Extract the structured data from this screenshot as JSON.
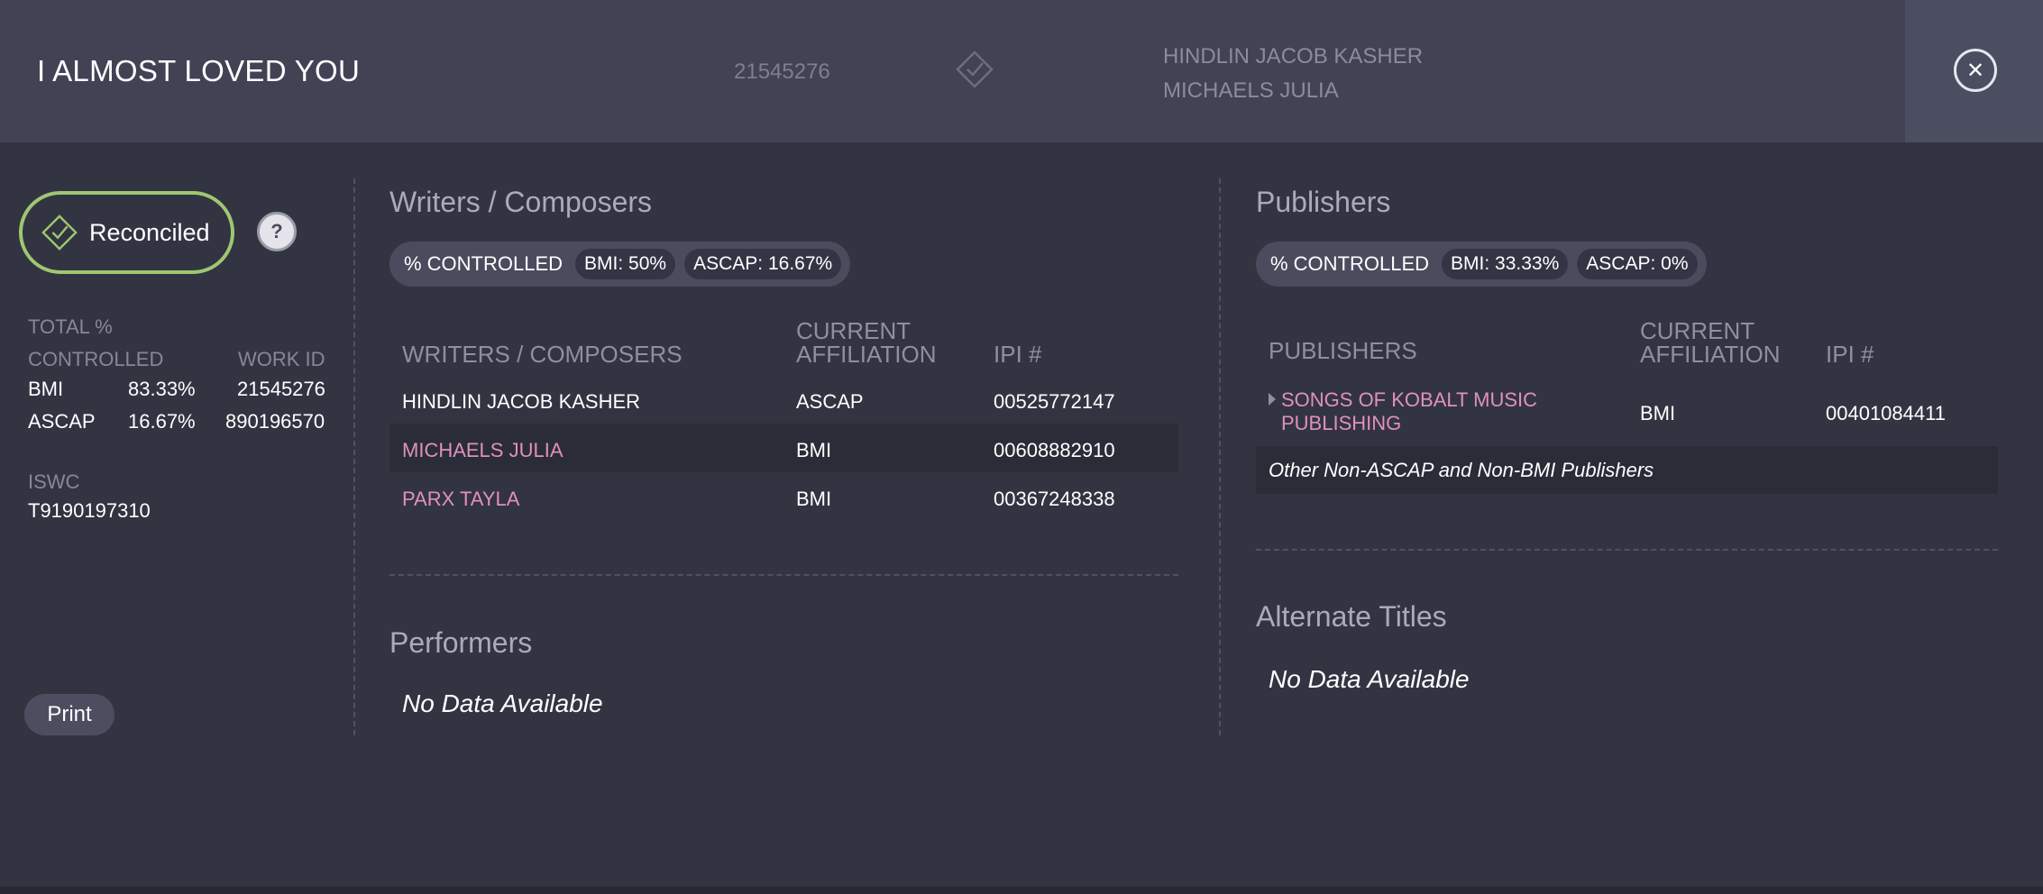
{
  "header": {
    "title": "I ALMOST LOVED YOU",
    "work_id": "21545276",
    "writers": [
      "HINDLIN JACOB KASHER",
      "MICHAELS JULIA"
    ]
  },
  "status": {
    "label": "Reconciled",
    "help": "?"
  },
  "summary": {
    "total_label": "TOTAL %",
    "controlled_label": "CONTROLLED",
    "work_id_label": "WORK ID",
    "rows": [
      {
        "org": "BMI",
        "pct": "83.33%",
        "work_id": "21545276"
      },
      {
        "org": "ASCAP",
        "pct": "16.67%",
        "work_id": "890196570"
      }
    ],
    "iswc_label": "ISWC",
    "iswc": "T9190197310"
  },
  "print_label": "Print",
  "writers": {
    "title": "Writers / Composers",
    "controlled": {
      "label": "% CONTROLLED",
      "bmi": "BMI: 50%",
      "ascap": "ASCAP: 16.67%"
    },
    "columns": [
      "WRITERS / COMPOSERS",
      "CURRENT\nAFFILIATION",
      "IPI #"
    ],
    "col_name": "WRITERS / COMPOSERS",
    "col_aff_1": "CURRENT",
    "col_aff_2": "AFFILIATION",
    "col_ipi": "IPI #",
    "rows": [
      {
        "name": "HINDLIN JACOB KASHER",
        "affiliation": "ASCAP",
        "ipi": "00525772147"
      },
      {
        "name": "MICHAELS JULIA",
        "affiliation": "BMI",
        "ipi": "00608882910"
      },
      {
        "name": "PARX TAYLA",
        "affiliation": "BMI",
        "ipi": "00367248338"
      }
    ]
  },
  "performers": {
    "title": "Performers",
    "empty": "No Data Available"
  },
  "publishers": {
    "title": "Publishers",
    "controlled": {
      "label": "% CONTROLLED",
      "bmi": "BMI: 33.33%",
      "ascap": "ASCAP: 0%"
    },
    "col_name": "PUBLISHERS",
    "col_aff_1": "CURRENT",
    "col_aff_2": "AFFILIATION",
    "col_ipi": "IPI #",
    "rows": [
      {
        "name_1": "SONGS OF KOBALT MUSIC",
        "name_2": "PUBLISHING",
        "affiliation": "BMI",
        "ipi": "00401084411"
      }
    ],
    "other": "Other Non-ASCAP and Non-BMI Publishers"
  },
  "alternate_titles": {
    "title": "Alternate Titles",
    "empty": "No Data Available"
  },
  "colors": {
    "accent_green": "#9ec770",
    "link_pink": "#e090bd",
    "background": "#323442",
    "header_bg": "#414355"
  }
}
